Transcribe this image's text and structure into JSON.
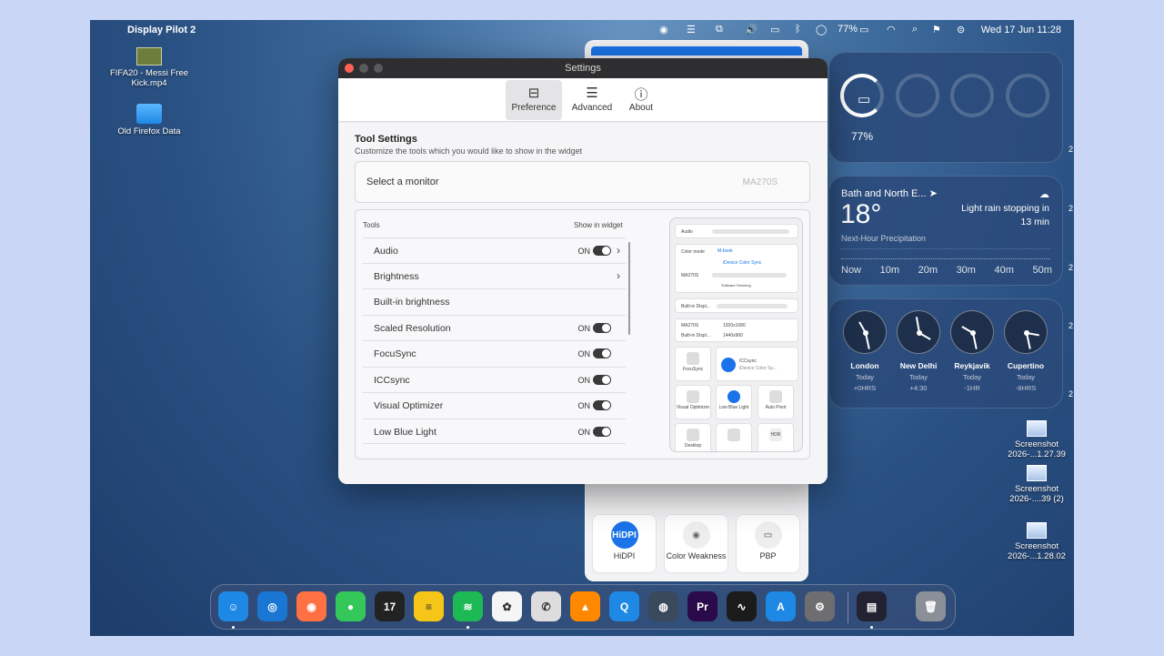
{
  "menubar": {
    "app_name": "Display Pilot 2",
    "battery_pct": "77%",
    "datetime": "Wed 17 Jun  11:28"
  },
  "desktop_icons": [
    {
      "label": "FIFA20 - Messi Free Kick.mp4",
      "icon": "video-thumbnail"
    },
    {
      "label": "Old Firefox Data",
      "icon": "folder"
    },
    {
      "label": "Screenshot 2026-...1.27.39",
      "icon": "screenshot-file"
    },
    {
      "label": "Screenshot 2026-....39 (2)",
      "icon": "screenshot-file"
    },
    {
      "label": "Screenshot 2026-...1.28.02",
      "icon": "screenshot-file"
    }
  ],
  "battery_widget": {
    "percent": "77%"
  },
  "weather_widget": {
    "location": "Bath and North E...",
    "temperature": "18°",
    "description": "Light rain stopping in 13 min",
    "subtitle": "Next-Hour Precipitation",
    "times": [
      "Now",
      "10m",
      "20m",
      "30m",
      "40m",
      "50m"
    ]
  },
  "clock_widget": [
    {
      "city": "London",
      "day": "Today",
      "offset": "+0HRS"
    },
    {
      "city": "New Delhi",
      "day": "Today",
      "offset": "+4:30"
    },
    {
      "city": "Reykjavik",
      "day": "Today",
      "offset": "-1HR"
    },
    {
      "city": "Cupertino",
      "day": "Today",
      "offset": "-8HRS"
    }
  ],
  "display_pilot_panel": {
    "tiles": [
      {
        "label": "HiDPI",
        "icon_text": "HiDPI"
      },
      {
        "label": "Color Weakness",
        "icon_text": "◉"
      },
      {
        "label": "PBP",
        "icon_text": "▭"
      }
    ]
  },
  "settings": {
    "title": "Settings",
    "tabs": [
      {
        "label": "Preference",
        "icon": "toggles-icon",
        "active": true
      },
      {
        "label": "Advanced",
        "icon": "sliders-icon",
        "active": false
      },
      {
        "label": "About",
        "icon": "info-icon",
        "active": false
      }
    ],
    "heading": "Tool Settings",
    "subheading": "Customize the tools which you would like to show in the widget",
    "monitor_label": "Select a monitor",
    "monitor_value": "MA270S",
    "tools_header": "Tools",
    "show_header": "Show in widget",
    "tools": [
      {
        "name": "Audio",
        "state": "ON",
        "toggle": true,
        "chevron": true
      },
      {
        "name": "Brightness",
        "state": "",
        "toggle": false,
        "chevron": true
      },
      {
        "name": "Built-in brightness",
        "state": "",
        "toggle": false,
        "chevron": false
      },
      {
        "name": "Scaled Resolution",
        "state": "ON",
        "toggle": true,
        "chevron": false
      },
      {
        "name": "FocuSync",
        "state": "ON",
        "toggle": true,
        "chevron": false
      },
      {
        "name": "ICCsync",
        "state": "ON",
        "toggle": true,
        "chevron": false
      },
      {
        "name": "Visual Optimizer",
        "state": "ON",
        "toggle": true,
        "chevron": false
      },
      {
        "name": "Low Blue Light",
        "state": "ON",
        "toggle": true,
        "chevron": false
      }
    ],
    "preview": {
      "audio": "Audio",
      "color_mode": "Color mode",
      "color_mode_value": "M-book",
      "idevice_sync": "iDevice Color Sync",
      "monitor": "MA270S",
      "software_dimming": "Software Dimming",
      "builtin": "Built-in Displ...",
      "res1": "1920x1080",
      "res2": "1440x900",
      "focusync": "FocuSync",
      "iccsync": "ICCsync",
      "iccsync_sub": "iDevice Color Sy...",
      "visual_optimizer": "Visual Optimizer",
      "low_blue": "Low Blue Light",
      "auto_pivot": "Auto Pivot",
      "desktop": "Desktop",
      "hdr": "HDR"
    }
  },
  "dock": {
    "apps": [
      {
        "name": "finder",
        "color": "#1e88e5",
        "glyph": "☺"
      },
      {
        "name": "safari",
        "color": "#1976d2",
        "glyph": "◎"
      },
      {
        "name": "firefox",
        "color": "#ff7043",
        "glyph": "◉"
      },
      {
        "name": "messages",
        "color": "#34c759",
        "glyph": "●"
      },
      {
        "name": "calendar",
        "color": "#222222",
        "glyph": "17"
      },
      {
        "name": "notes",
        "color": "#f5c518",
        "glyph": "≡"
      },
      {
        "name": "spotify",
        "color": "#1db954",
        "glyph": "≋"
      },
      {
        "name": "photos",
        "color": "#f5f5f5",
        "glyph": "✿"
      },
      {
        "name": "whatsapp",
        "color": "#dddddd",
        "glyph": "✆"
      },
      {
        "name": "vlc",
        "color": "#ff8800",
        "glyph": "▲"
      },
      {
        "name": "quicktime",
        "color": "#1e88e5",
        "glyph": "Q"
      },
      {
        "name": "xcode-speaker",
        "color": "#3a4a5c",
        "glyph": "◍"
      },
      {
        "name": "premiere",
        "color": "#2a0a4a",
        "glyph": "Pr"
      },
      {
        "name": "activity-monitor",
        "color": "#1b1b1b",
        "glyph": "∿"
      },
      {
        "name": "app-store",
        "color": "#1e88e5",
        "glyph": "A"
      },
      {
        "name": "system-settings",
        "color": "#6e6e70",
        "glyph": "⚙"
      },
      {
        "name": "display-pilot",
        "color": "#222233",
        "glyph": "▤"
      },
      {
        "name": "trash",
        "color": "#8a8f98",
        "glyph": "🗑"
      }
    ]
  }
}
